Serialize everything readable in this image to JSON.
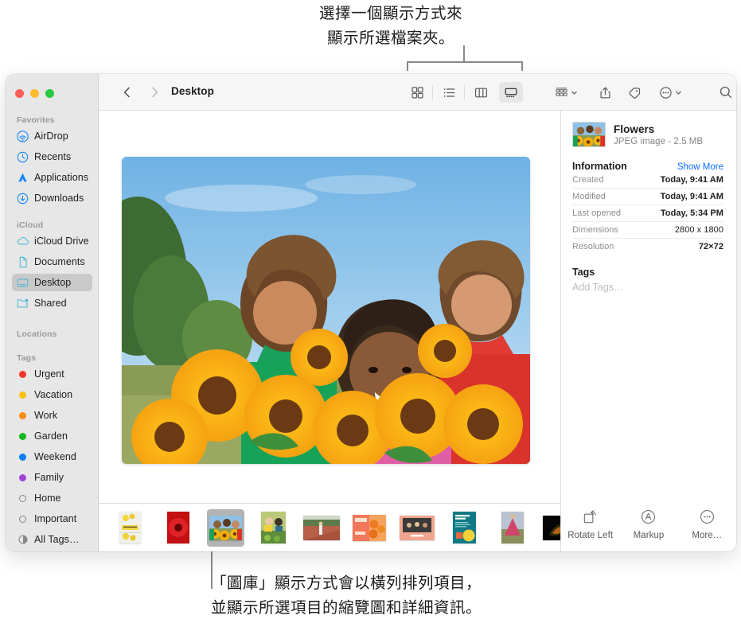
{
  "annotations": {
    "top": "選擇一個顯示方式來\n顯示所選檔案夾。",
    "bottom": "「圖庫」顯示方式會以橫列排列項目，\n並顯示所選項目的縮覽圖和詳細資訊。"
  },
  "window": {
    "traffic_lights": [
      {
        "name": "close",
        "color": "#ff5f57"
      },
      {
        "name": "minimize",
        "color": "#febc2e"
      },
      {
        "name": "zoom",
        "color": "#28c840"
      }
    ]
  },
  "toolbar": {
    "back_label": "Back",
    "forward_label": "Forward",
    "path_title": "Desktop",
    "view_buttons": [
      {
        "name": "icon-view",
        "label": "as Icons",
        "selected": false
      },
      {
        "name": "list-view",
        "label": "as List",
        "selected": false
      },
      {
        "name": "column-view",
        "label": "as Columns",
        "selected": false
      },
      {
        "name": "gallery-view",
        "label": "as Gallery",
        "selected": true
      }
    ],
    "group_label": "Group",
    "share_label": "Share",
    "tag_label": "Edit Tags",
    "more_label": "More",
    "search_label": "Search"
  },
  "sidebar": {
    "sections": [
      {
        "header": "Favorites",
        "items": [
          {
            "label": "AirDrop",
            "icon": "airdrop-icon",
            "selected": false
          },
          {
            "label": "Recents",
            "icon": "clock-icon",
            "selected": false
          },
          {
            "label": "Applications",
            "icon": "applications-icon",
            "selected": false
          },
          {
            "label": "Downloads",
            "icon": "download-icon",
            "selected": false
          }
        ]
      },
      {
        "header": "iCloud",
        "items": [
          {
            "label": "iCloud Drive",
            "icon": "cloud-icon",
            "selected": false
          },
          {
            "label": "Documents",
            "icon": "document-icon",
            "selected": false
          },
          {
            "label": "Desktop",
            "icon": "desktop-icon",
            "selected": true
          },
          {
            "label": "Shared",
            "icon": "shared-folder-icon",
            "selected": false
          }
        ]
      },
      {
        "header": "Locations",
        "items": []
      },
      {
        "header": "Tags",
        "items": [
          {
            "label": "Urgent",
            "icon": "tag-dot",
            "color": "#f5352b"
          },
          {
            "label": "Vacation",
            "icon": "tag-dot",
            "color": "#f9c10f"
          },
          {
            "label": "Work",
            "icon": "tag-dot",
            "color": "#f78c0c"
          },
          {
            "label": "Garden",
            "icon": "tag-dot",
            "color": "#16b71f"
          },
          {
            "label": "Weekend",
            "icon": "tag-dot",
            "color": "#0a7ff5"
          },
          {
            "label": "Family",
            "icon": "tag-dot",
            "color": "#a241d6"
          },
          {
            "label": "Home",
            "icon": "tag-ring",
            "color": "transparent"
          },
          {
            "label": "Important",
            "icon": "tag-ring",
            "color": "transparent"
          },
          {
            "label": "All Tags…",
            "icon": "all-tags-icon",
            "color": "transparent"
          }
        ]
      }
    ]
  },
  "preview": {
    "alt": "Three people holding large sunflower bouquets outdoors under a blue sky"
  },
  "filmstrip": {
    "items": [
      {
        "name": "lemons-poster",
        "selected": false
      },
      {
        "name": "red-flower",
        "selected": false
      },
      {
        "name": "flowers-sunflowers",
        "selected": true
      },
      {
        "name": "garden-harvest",
        "selected": false
      },
      {
        "name": "runner-track",
        "selected": false
      },
      {
        "name": "orange-food-flyer",
        "selected": false
      },
      {
        "name": "group-photo-card",
        "selected": false
      },
      {
        "name": "marketing-plan-cover",
        "selected": false
      },
      {
        "name": "red-dress-field",
        "selected": false
      },
      {
        "name": "dark-leaf",
        "selected": false
      },
      {
        "name": "spreadsheet-doc",
        "selected": false
      }
    ]
  },
  "info": {
    "file_name": "Flowers",
    "file_subtitle": "JPEG image - 2.5 MB",
    "section_title": "Information",
    "show_more": "Show More",
    "rows": [
      {
        "key": "Created",
        "value": "Today, 9:41 AM",
        "bold": true
      },
      {
        "key": "Modified",
        "value": "Today, 9:41 AM",
        "bold": true
      },
      {
        "key": "Last opened",
        "value": "Today, 5:34 PM",
        "bold": true
      },
      {
        "key": "Dimensions",
        "value": "2800 x 1800",
        "bold": false
      },
      {
        "key": "Resolution",
        "value": "72×72",
        "bold": true
      }
    ],
    "tags_title": "Tags",
    "add_tags_placeholder": "Add Tags…",
    "actions": [
      {
        "label": "Rotate Left",
        "icon": "rotate-left-icon"
      },
      {
        "label": "Markup",
        "icon": "markup-icon"
      },
      {
        "label": "More…",
        "icon": "more-icon"
      }
    ]
  }
}
